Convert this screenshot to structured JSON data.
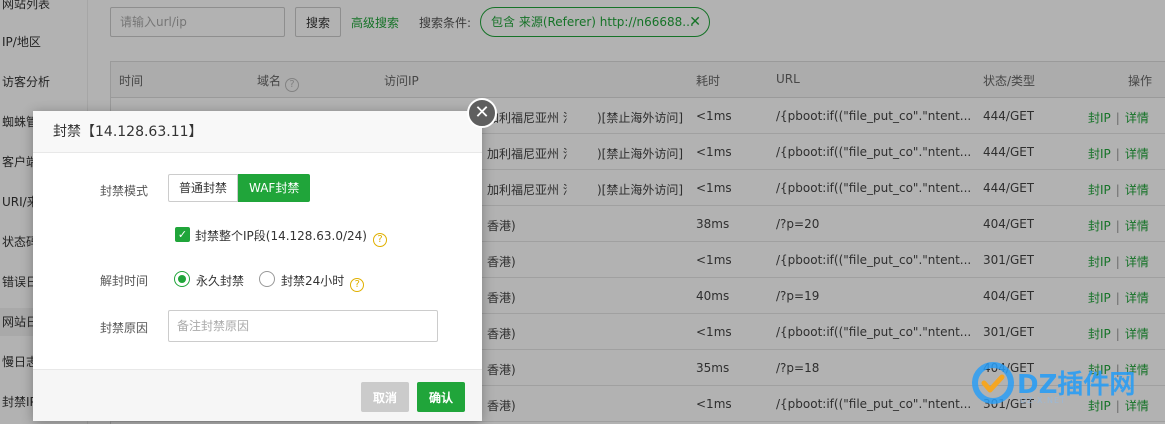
{
  "sidebar": {
    "items": [
      {
        "label": "网站列表"
      },
      {
        "label": "IP/地区"
      },
      {
        "label": "访客分析"
      },
      {
        "label": "蜘蛛管"
      },
      {
        "label": "客户端"
      },
      {
        "label": "URI/来"
      },
      {
        "label": "状态码"
      },
      {
        "label": "错误日"
      },
      {
        "label": "网站日"
      },
      {
        "label": "慢日志"
      },
      {
        "label": "封禁IP"
      }
    ]
  },
  "search": {
    "placeholder": "请输入url/ip",
    "button_label": "搜索",
    "advanced_label": "高级搜索",
    "condition_label": "搜索条件:",
    "condition_tag": "包含 来源(Referer) http://n66688...",
    "condition_close": "✕"
  },
  "table": {
    "columns": [
      "时间",
      "域名",
      "访问IP",
      "耗时",
      "URL",
      "状态/类型",
      "操作"
    ],
    "rows": [
      {
        "ip": "加利福尼亚州 洛...",
        "tag": ")[禁止海外访问]",
        "time": "<1ms",
        "url": "/{pboot:if((\"file_put_co\".\"ntent...",
        "status": "444/GET"
      },
      {
        "ip": "加利福尼亚州 洛...",
        "tag": ")[禁止海外访问]",
        "time": "<1ms",
        "url": "/{pboot:if((\"file_put_co\".\"ntent...",
        "status": "444/GET"
      },
      {
        "ip": "加利福尼亚州 洛...",
        "tag": ")[禁止海外访问]",
        "time": "<1ms",
        "url": "/{pboot:if((\"file_put_co\".\"ntent...",
        "status": "444/GET"
      },
      {
        "ip": "香港)",
        "tag": "",
        "time": "38ms",
        "url": "/?p=20",
        "status": "404/GET"
      },
      {
        "ip": "香港)",
        "tag": "",
        "time": "<1ms",
        "url": "/{pboot:if((\"file_put_co\".\"ntent...",
        "status": "301/GET"
      },
      {
        "ip": "香港)",
        "tag": "",
        "time": "40ms",
        "url": "/?p=19",
        "status": "404/GET"
      },
      {
        "ip": "香港)",
        "tag": "",
        "time": "<1ms",
        "url": "/{pboot:if((\"file_put_co\".\"ntent...",
        "status": "301/GET"
      },
      {
        "ip": "香港)",
        "tag": "",
        "time": "35ms",
        "url": "/?p=18",
        "status": "404/GET"
      },
      {
        "ip": "香港)",
        "tag": "",
        "time": "<1ms",
        "url": "/{pboot:if((\"file_put_co\".\"ntent...",
        "status": "301/GET"
      }
    ],
    "op_block": "封IP",
    "op_sep": "|",
    "op_detail": "详情"
  },
  "dialog": {
    "title": "封禁【14.128.63.11】",
    "close_glyph": "✕",
    "mode_label": "封禁模式",
    "mode_normal": "普通封禁",
    "mode_waf": "WAF封禁",
    "checkbox_label": "封禁整个IP段(14.128.63.0/24)",
    "unblock_label": "解封时间",
    "radio_permanent": "永久封禁",
    "radio_24h": "封禁24小时",
    "reason_label": "封禁原因",
    "reason_placeholder": "备注封禁原因",
    "cancel_label": "取消",
    "confirm_label": "确认"
  },
  "watermark": {
    "text": "DZ插件网",
    "sub": "DZ-X.NET"
  },
  "colors": {
    "accent": "#20a53a",
    "mask": "rgba(0,0,0,0.3)",
    "watermark": "#2a9df4"
  }
}
